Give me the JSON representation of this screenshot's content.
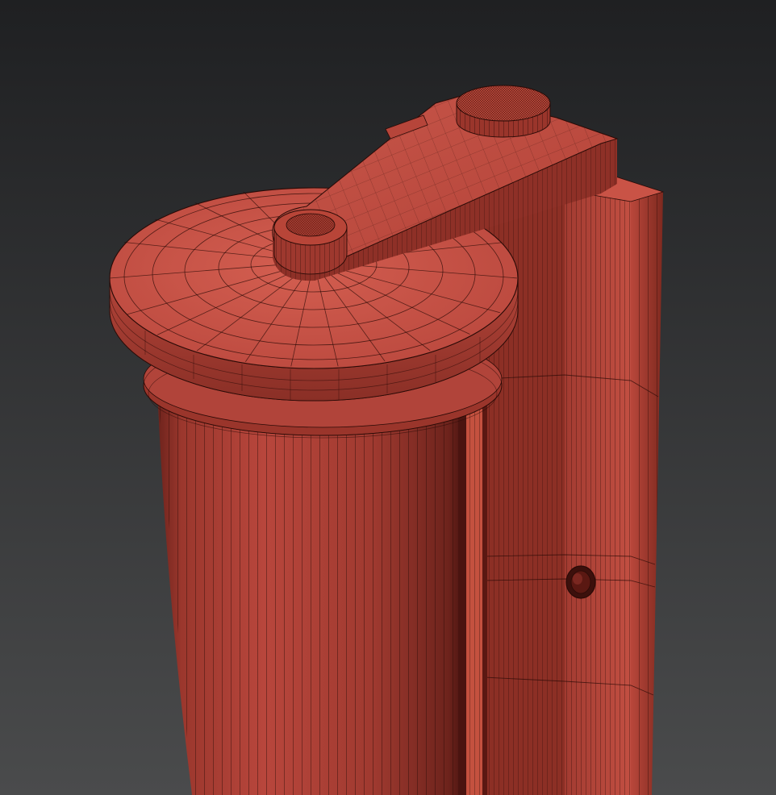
{
  "scene": {
    "kind": "3d-viewport-wireframe-render",
    "colors": {
      "background_top": "#1f2022",
      "background_bottom": "#4a4b4c",
      "mesh_base": "#b8463c",
      "mesh_light": "#cf5a4c",
      "mesh_mid": "#a33a30",
      "mesh_dark": "#7a2720",
      "mesh_shadow": "#4a1410",
      "wire": "#2a0a06"
    },
    "parts": [
      "cylinder-body",
      "cylinder-lid",
      "lid-rim",
      "swing-arm",
      "pivot-knob-small",
      "pivot-knob-large",
      "side-bracket-post",
      "bracket-bolt-hole"
    ]
  }
}
